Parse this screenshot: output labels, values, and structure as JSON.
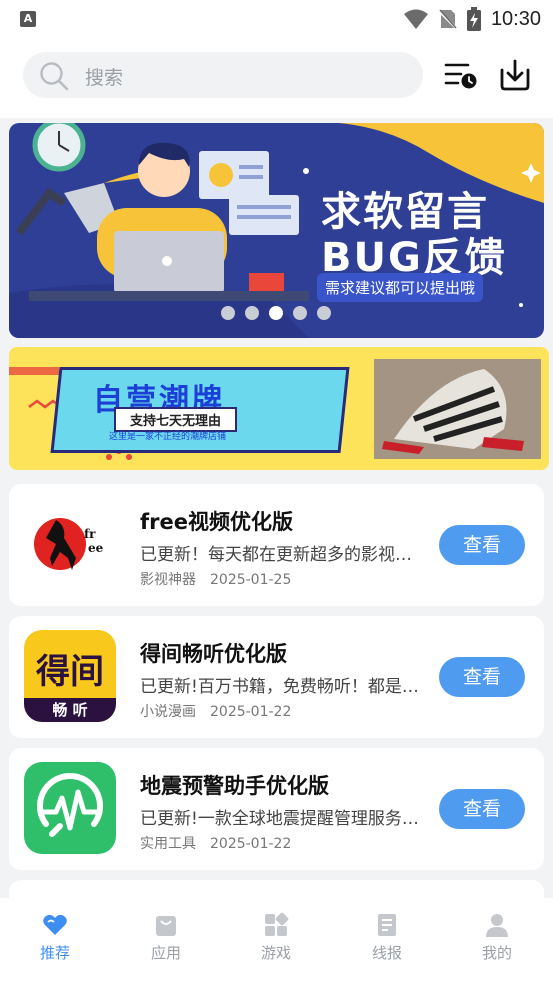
{
  "status_bar": {
    "time": "10:30"
  },
  "search": {
    "placeholder": "搜索"
  },
  "banner": {
    "title_line1": "求软留言",
    "title_line2": "BUG反馈",
    "subtitle": "需求建议都可以提出哦",
    "dots_count": 5,
    "active_dot": 2
  },
  "promo": {
    "title": "自营潮牌",
    "subtitle": "支持七天无理由",
    "small_text": "这里是一家不正经的潮牌店铺"
  },
  "apps": [
    {
      "name": "free视频优化版",
      "desc": "已更新！每天都在更新超多的影视资源",
      "category": "影视神器",
      "date": "2025-01-25",
      "button": "查看",
      "icon": "free-video-icon"
    },
    {
      "name": "得间畅听优化版",
      "desc": "已更新!百万书籍，免费畅听！都是精品",
      "category": "小说漫画",
      "date": "2025-01-22",
      "button": "查看",
      "icon": "dejian-listen-icon",
      "icon_text_top": "得间",
      "icon_text_bottom": "畅 听"
    },
    {
      "name": "地震预警助手优化版",
      "desc": "已更新!一款全球地震提醒管理服务软件",
      "category": "实用工具",
      "date": "2025-01-22",
      "button": "查看",
      "icon": "earthquake-icon"
    }
  ],
  "tabs": [
    {
      "label": "推荐",
      "icon": "heart-icon",
      "active": true
    },
    {
      "label": "应用",
      "icon": "bag-icon",
      "active": false
    },
    {
      "label": "游戏",
      "icon": "grid-icon",
      "active": false
    },
    {
      "label": "线报",
      "icon": "book-icon",
      "active": false
    },
    {
      "label": "我的",
      "icon": "user-icon",
      "active": false
    }
  ],
  "colors": {
    "accent": "#3d8ef0",
    "button": "#4f9bf0",
    "inactive": "#9aa0a6"
  }
}
